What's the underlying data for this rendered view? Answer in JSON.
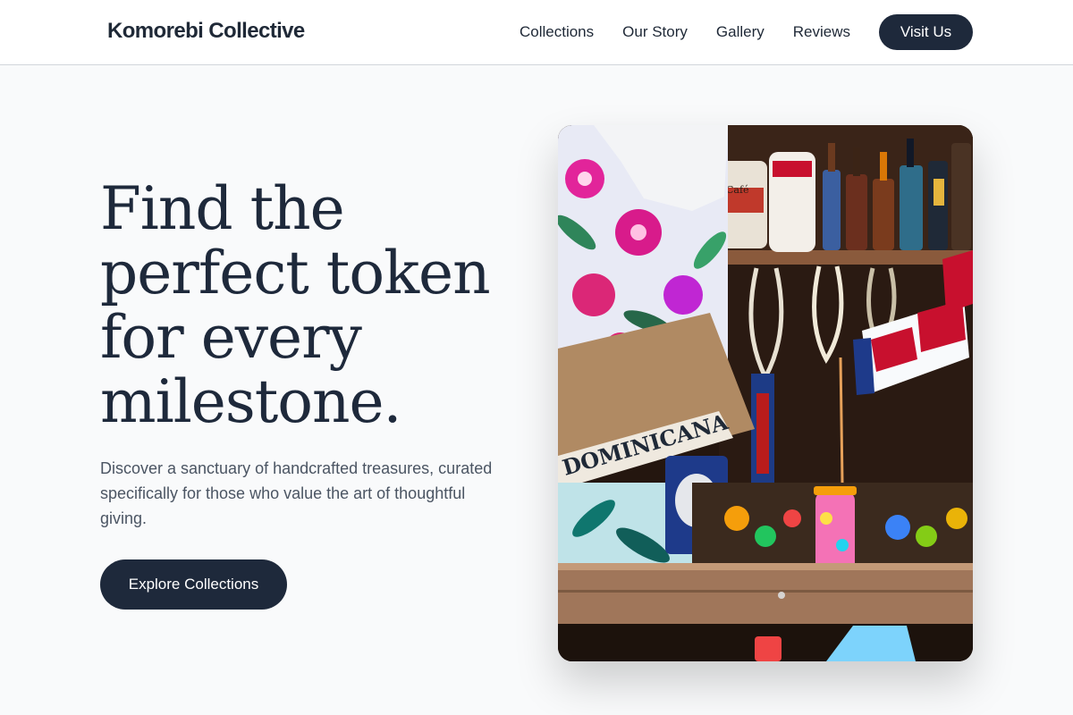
{
  "brand": {
    "name": "Komorebi Collective"
  },
  "nav": {
    "items": [
      "Collections",
      "Our Story",
      "Gallery",
      "Reviews"
    ],
    "cta": "Visit Us"
  },
  "hero": {
    "headline_lines": [
      "Find the",
      "perfect token",
      "for every",
      "milestone."
    ],
    "subtitle": "Discover a sanctuary of handcrafted treasures, curated specifically for those who value the art of thoughtful giving.",
    "button": "Explore Collections",
    "image": {
      "banner_text": "DOMINICANA",
      "cup_label": "Café",
      "colors": {
        "dark": "#1e293b",
        "flag_red": "#c8102e",
        "flag_blue": "#1e3a8a",
        "wood": "#a0765a"
      }
    }
  }
}
